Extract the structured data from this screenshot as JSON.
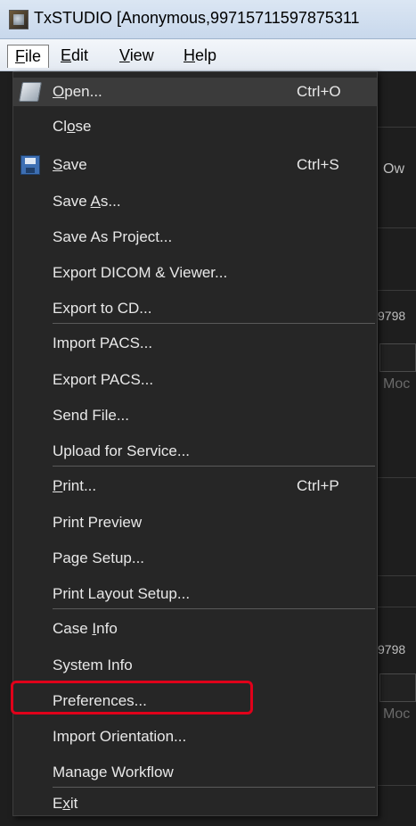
{
  "window": {
    "title": "TxSTUDIO [Anonymous,99715711597875311"
  },
  "menubar": [
    {
      "pre": "",
      "u": "F",
      "post": "ile"
    },
    {
      "pre": "",
      "u": "E",
      "post": "dit"
    },
    {
      "pre": "",
      "u": "V",
      "post": "iew"
    },
    {
      "pre": "",
      "u": "H",
      "post": "elp"
    }
  ],
  "file_menu": {
    "items": [
      {
        "pre": "",
        "u": "O",
        "post": "pen...",
        "shortcut": "Ctrl+O",
        "icon": "folder-open-icon"
      },
      {
        "pre": "Cl",
        "u": "o",
        "post": "se",
        "shortcut": ""
      },
      {
        "pre": "",
        "u": "S",
        "post": "ave",
        "shortcut": "Ctrl+S",
        "icon": "save-disk-icon"
      },
      {
        "pre": "Save ",
        "u": "A",
        "post": "s...",
        "shortcut": ""
      },
      {
        "pre": "Save As Project...",
        "u": "",
        "post": "",
        "shortcut": ""
      },
      {
        "pre": "Export DICOM & Viewer...",
        "u": "",
        "post": "",
        "shortcut": ""
      },
      {
        "pre": "Export to CD...",
        "u": "",
        "post": "",
        "shortcut": ""
      },
      {
        "pre": "Import PACS...",
        "u": "",
        "post": "",
        "shortcut": ""
      },
      {
        "pre": "Export PACS...",
        "u": "",
        "post": "",
        "shortcut": ""
      },
      {
        "pre": "Send File...",
        "u": "",
        "post": "",
        "shortcut": ""
      },
      {
        "pre": "Upload for Service...",
        "u": "",
        "post": "",
        "shortcut": ""
      },
      {
        "pre": "",
        "u": "P",
        "post": "rint...",
        "shortcut": "Ctrl+P"
      },
      {
        "pre": "Print Preview",
        "u": "",
        "post": "",
        "shortcut": ""
      },
      {
        "pre": "Page Setup...",
        "u": "",
        "post": "",
        "shortcut": ""
      },
      {
        "pre": "Print Layout Setup...",
        "u": "",
        "post": "",
        "shortcut": ""
      },
      {
        "pre": "Case ",
        "u": "I",
        "post": "nfo",
        "shortcut": ""
      },
      {
        "pre": "System Info",
        "u": "",
        "post": "",
        "shortcut": ""
      },
      {
        "pre": "Preferences...",
        "u": "",
        "post": "",
        "shortcut": ""
      },
      {
        "pre": "Import Orientation...",
        "u": "",
        "post": "",
        "shortcut": "",
        "highlighted": true
      },
      {
        "pre": "Manage Workflow",
        "u": "",
        "post": "",
        "shortcut": ""
      },
      {
        "pre": "E",
        "u": "x",
        "post": "it",
        "shortcut": ""
      }
    ]
  },
  "background_fragments": {
    "ow": "Ow",
    "num1": "9798",
    "mod1": "Moc",
    "num2": "9798",
    "mod2": "Moc"
  },
  "colors": {
    "menu_bg": "#262626",
    "menu_text": "#e8e8e8",
    "highlight": "#e0001a"
  }
}
